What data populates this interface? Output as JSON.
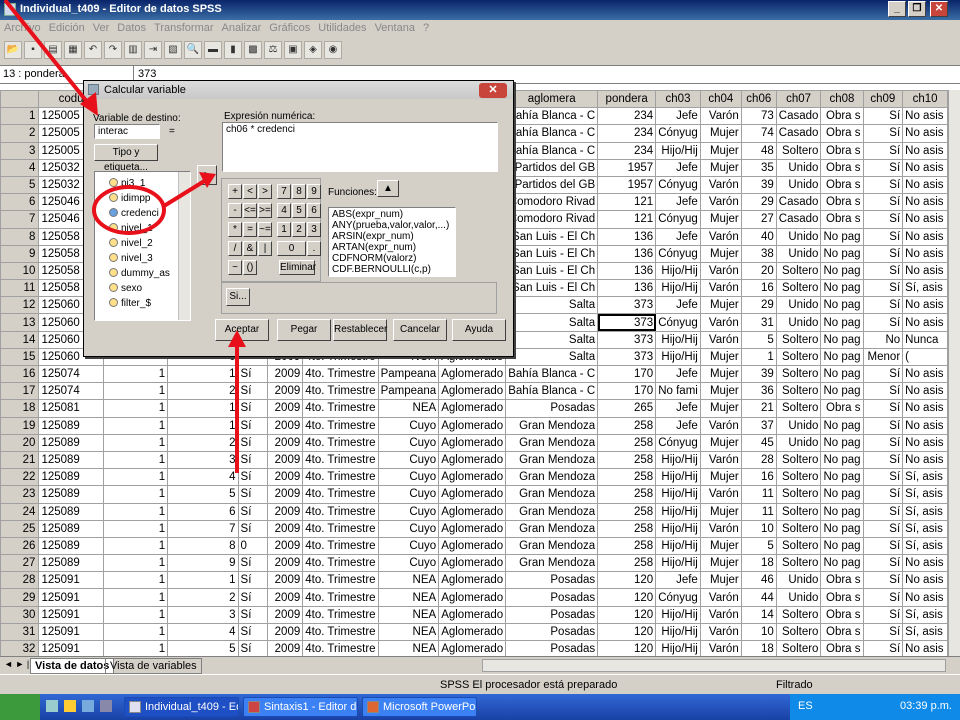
{
  "window": {
    "title": "Individual_t409 - Editor de datos SPSS"
  },
  "menu": [
    "Archivo",
    "Edición",
    "Ver",
    "Datos",
    "Transformar",
    "Analizar",
    "Gráficos",
    "Utilidades",
    "Ventana",
    "?"
  ],
  "cell": {
    "ref": "13 : pondera",
    "value": "373"
  },
  "grid": {
    "headers": [
      "",
      "codu",
      "",
      "",
      "",
      "",
      "",
      "",
      "",
      "aglomera",
      "pondera",
      "ch03",
      "ch04",
      "ch06",
      "ch07",
      "ch08",
      "ch09",
      "ch10"
    ],
    "rows": [
      [
        "1",
        "125005",
        "",
        "",
        "",
        "",
        "",
        "",
        "do",
        "Bahía Blanca - C",
        "234",
        "Jefe",
        "Varón",
        "73",
        "Casado",
        "Obra s",
        "Sí",
        "No asis"
      ],
      [
        "2",
        "125005",
        "",
        "",
        "",
        "",
        "",
        "",
        "do",
        "Bahía Blanca - C",
        "234",
        "Cónyug",
        "Mujer",
        "74",
        "Casado",
        "Obra s",
        "Sí",
        "No asis"
      ],
      [
        "3",
        "125005",
        "",
        "",
        "",
        "",
        "",
        "",
        "do",
        "Bahía Blanca - C",
        "234",
        "Hijo/Hij",
        "Mujer",
        "48",
        "Soltero",
        "Obra s",
        "Sí",
        "No asis"
      ],
      [
        "4",
        "125032",
        "",
        "",
        "",
        "",
        "",
        "",
        "do",
        "Partidos del GB",
        "1957",
        "Jefe",
        "Mujer",
        "35",
        "Unido",
        "Obra s",
        "Sí",
        "No asis"
      ],
      [
        "5",
        "125032",
        "",
        "",
        "",
        "",
        "",
        "",
        "do",
        "Partidos del GB",
        "1957",
        "Cónyug",
        "Varón",
        "39",
        "Unido",
        "Obra s",
        "Sí",
        "No asis"
      ],
      [
        "6",
        "125046",
        "",
        "",
        "",
        "",
        "",
        "",
        "do",
        "Comodoro Rivad",
        "121",
        "Jefe",
        "Varón",
        "29",
        "Casado",
        "Obra s",
        "Sí",
        "No asis"
      ],
      [
        "7",
        "125046",
        "",
        "",
        "",
        "",
        "",
        "",
        "do",
        "Comodoro Rivad",
        "121",
        "Cónyug",
        "Mujer",
        "27",
        "Casado",
        "Obra s",
        "Sí",
        "No asis"
      ],
      [
        "8",
        "125058",
        "",
        "",
        "",
        "",
        "",
        "",
        "do",
        "San Luis - El Ch",
        "136",
        "Jefe",
        "Varón",
        "40",
        "Unido",
        "No pag",
        "Sí",
        "No asis"
      ],
      [
        "9",
        "125058",
        "",
        "",
        "",
        "",
        "",
        "",
        "do",
        "San Luis - El Ch",
        "136",
        "Cónyug",
        "Mujer",
        "38",
        "Unido",
        "No pag",
        "Sí",
        "No asis"
      ],
      [
        "10",
        "125058",
        "",
        "",
        "",
        "",
        "",
        "",
        "do",
        "San Luis - El Ch",
        "136",
        "Hijo/Hij",
        "Varón",
        "20",
        "Soltero",
        "No pag",
        "Sí",
        "No asis"
      ],
      [
        "11",
        "125058",
        "",
        "",
        "",
        "",
        "",
        "",
        "do",
        "San Luis - El Ch",
        "136",
        "Hijo/Hij",
        "Varón",
        "16",
        "Soltero",
        "No pag",
        "Sí",
        "Sí, asis"
      ],
      [
        "12",
        "125060",
        "",
        "",
        "",
        "",
        "",
        "",
        "do",
        "Salta",
        "373",
        "Jefe",
        "Mujer",
        "29",
        "Unido",
        "No pag",
        "Sí",
        "No asis"
      ],
      [
        "13",
        "125060",
        "",
        "",
        "",
        "",
        "",
        "",
        "do",
        "Salta",
        "373",
        "Cónyug",
        "Varón",
        "31",
        "Unido",
        "No pag",
        "Sí",
        "No asis"
      ],
      [
        "14",
        "125060",
        "",
        "",
        "",
        "",
        "",
        "",
        "do",
        "Salta",
        "373",
        "Hijo/Hij",
        "Varón",
        "5",
        "Soltero",
        "No pag",
        "No",
        "Nunca"
      ],
      [
        "15",
        "125060",
        "",
        "0",
        "",
        "2009",
        "4to. Trimestre",
        "NOA",
        "Aglomerado",
        "Salta",
        "373",
        "Hijo/Hij",
        "Mujer",
        "1",
        "Soltero",
        "No pag",
        "Menor",
        "("
      ],
      [
        "16",
        "125074",
        "1",
        "1",
        "Sí",
        "2009",
        "4to. Trimestre",
        "Pampeana",
        "Aglomerado",
        "Bahía Blanca - C",
        "170",
        "Jefe",
        "Mujer",
        "39",
        "Soltero",
        "No pag",
        "Sí",
        "No asis"
      ],
      [
        "17",
        "125074",
        "1",
        "2",
        "Sí",
        "2009",
        "4to. Trimestre",
        "Pampeana",
        "Aglomerado",
        "Bahía Blanca - C",
        "170",
        "No fami",
        "Mujer",
        "36",
        "Soltero",
        "No pag",
        "Sí",
        "No asis"
      ],
      [
        "18",
        "125081",
        "1",
        "1",
        "Sí",
        "2009",
        "4to. Trimestre",
        "NEA",
        "Aglomerado",
        "Posadas",
        "265",
        "Jefe",
        "Mujer",
        "21",
        "Soltero",
        "Obra s",
        "Sí",
        "No asis"
      ],
      [
        "19",
        "125089",
        "1",
        "1",
        "Sí",
        "2009",
        "4to. Trimestre",
        "Cuyo",
        "Aglomerado",
        "Gran Mendoza",
        "258",
        "Jefe",
        "Varón",
        "37",
        "Unido",
        "No pag",
        "Sí",
        "No asis"
      ],
      [
        "20",
        "125089",
        "1",
        "2",
        "Sí",
        "2009",
        "4to. Trimestre",
        "Cuyo",
        "Aglomerado",
        "Gran Mendoza",
        "258",
        "Cónyug",
        "Mujer",
        "45",
        "Unido",
        "No pag",
        "Sí",
        "No asis"
      ],
      [
        "21",
        "125089",
        "1",
        "3",
        "Sí",
        "2009",
        "4to. Trimestre",
        "Cuyo",
        "Aglomerado",
        "Gran Mendoza",
        "258",
        "Hijo/Hij",
        "Varón",
        "28",
        "Soltero",
        "No pag",
        "Sí",
        "No asis"
      ],
      [
        "22",
        "125089",
        "1",
        "4",
        "Sí",
        "2009",
        "4to. Trimestre",
        "Cuyo",
        "Aglomerado",
        "Gran Mendoza",
        "258",
        "Hijo/Hij",
        "Mujer",
        "16",
        "Soltero",
        "No pag",
        "Sí",
        "Sí, asis"
      ],
      [
        "23",
        "125089",
        "1",
        "5",
        "Sí",
        "2009",
        "4to. Trimestre",
        "Cuyo",
        "Aglomerado",
        "Gran Mendoza",
        "258",
        "Hijo/Hij",
        "Varón",
        "11",
        "Soltero",
        "No pag",
        "Sí",
        "Sí, asis"
      ],
      [
        "24",
        "125089",
        "1",
        "6",
        "Sí",
        "2009",
        "4to. Trimestre",
        "Cuyo",
        "Aglomerado",
        "Gran Mendoza",
        "258",
        "Hijo/Hij",
        "Mujer",
        "11",
        "Soltero",
        "No pag",
        "Sí",
        "Sí, asis"
      ],
      [
        "25",
        "125089",
        "1",
        "7",
        "Sí",
        "2009",
        "4to. Trimestre",
        "Cuyo",
        "Aglomerado",
        "Gran Mendoza",
        "258",
        "Hijo/Hij",
        "Varón",
        "10",
        "Soltero",
        "No pag",
        "Sí",
        "Sí, asis"
      ],
      [
        "26",
        "125089",
        "1",
        "8",
        "0",
        "2009",
        "4to. Trimestre",
        "Cuyo",
        "Aglomerado",
        "Gran Mendoza",
        "258",
        "Hijo/Hij",
        "Mujer",
        "5",
        "Soltero",
        "No pag",
        "Sí",
        "Sí, asis"
      ],
      [
        "27",
        "125089",
        "1",
        "9",
        "Sí",
        "2009",
        "4to. Trimestre",
        "Cuyo",
        "Aglomerado",
        "Gran Mendoza",
        "258",
        "Hijo/Hij",
        "Mujer",
        "18",
        "Soltero",
        "No pag",
        "Sí",
        "No asis"
      ],
      [
        "28",
        "125091",
        "1",
        "1",
        "Sí",
        "2009",
        "4to. Trimestre",
        "NEA",
        "Aglomerado",
        "Posadas",
        "120",
        "Jefe",
        "Mujer",
        "46",
        "Unido",
        "Obra s",
        "Sí",
        "No asis"
      ],
      [
        "29",
        "125091",
        "1",
        "2",
        "Sí",
        "2009",
        "4to. Trimestre",
        "NEA",
        "Aglomerado",
        "Posadas",
        "120",
        "Cónyug",
        "Varón",
        "44",
        "Unido",
        "Obra s",
        "Sí",
        "No asis"
      ],
      [
        "30",
        "125091",
        "1",
        "3",
        "Sí",
        "2009",
        "4to. Trimestre",
        "NEA",
        "Aglomerado",
        "Posadas",
        "120",
        "Hijo/Hij",
        "Varón",
        "14",
        "Soltero",
        "Obra s",
        "Sí",
        "Sí, asis"
      ],
      [
        "31",
        "125091",
        "1",
        "4",
        "Sí",
        "2009",
        "4to. Trimestre",
        "NEA",
        "Aglomerado",
        "Posadas",
        "120",
        "Hijo/Hij",
        "Varón",
        "10",
        "Soltero",
        "Obra s",
        "Sí",
        "Sí, asis"
      ],
      [
        "32",
        "125091",
        "1",
        "5",
        "Sí",
        "2009",
        "4to. Trimestre",
        "NEA",
        "Aglomerado",
        "Posadas",
        "120",
        "Hijo/Hij",
        "Varón",
        "18",
        "Soltero",
        "Obra s",
        "Sí",
        "No asis"
      ]
    ]
  },
  "tabs": {
    "data_view": "Vista de datos",
    "var_view": "Vista de variables"
  },
  "status": {
    "processor": "SPSS El procesador  está preparado",
    "filter": "Filtrado"
  },
  "dialog": {
    "title": "Calcular variable",
    "target_label": "Variable de destino:",
    "target_value": "interac",
    "equals": "=",
    "type_label_btn": "Tipo y etiqueta...",
    "expr_label": "Expresión numérica:",
    "expr_value": "ch06 * credenci",
    "variables": [
      "pj3_1",
      "idimpp",
      "credenci",
      "nivel_1",
      "nivel_2",
      "nivel_3",
      "dummy_as",
      "sexo",
      "filter_$"
    ],
    "functions_label": "Funciones:",
    "functions": [
      "ABS(expr_num)",
      "ANY(prueba,valor,valor,...)",
      "ARSIN(expr_num)",
      "ARTAN(expr_num)",
      "CDFNORM(valorz)",
      "CDF.BERNOULLI(c,p)"
    ],
    "keys": [
      "+",
      "<",
      ">",
      "7",
      "8",
      "9",
      "-",
      "<=",
      ">=",
      "4",
      "5",
      "6",
      "*",
      "=",
      "~=",
      "1",
      "2",
      "3",
      "/",
      "&",
      "|",
      "0",
      ".",
      "**",
      "~",
      "()"
    ],
    "delete_btn": "Eliminar",
    "if_btn": "Si...",
    "buttons": [
      "Aceptar",
      "Pegar",
      "Restablecer",
      "Cancelar",
      "Ayuda"
    ]
  },
  "taskbar": {
    "tasks": [
      "Individual_t409 - Edi...",
      "Sintaxis1 - Editor de ...",
      "Microsoft PowerPoi..."
    ],
    "lang": "ES",
    "clock": "03:39 p.m."
  },
  "colors": {
    "annotation": "#e8101a",
    "title_bg": "#0a246a",
    "taskbar": "#245edb"
  }
}
